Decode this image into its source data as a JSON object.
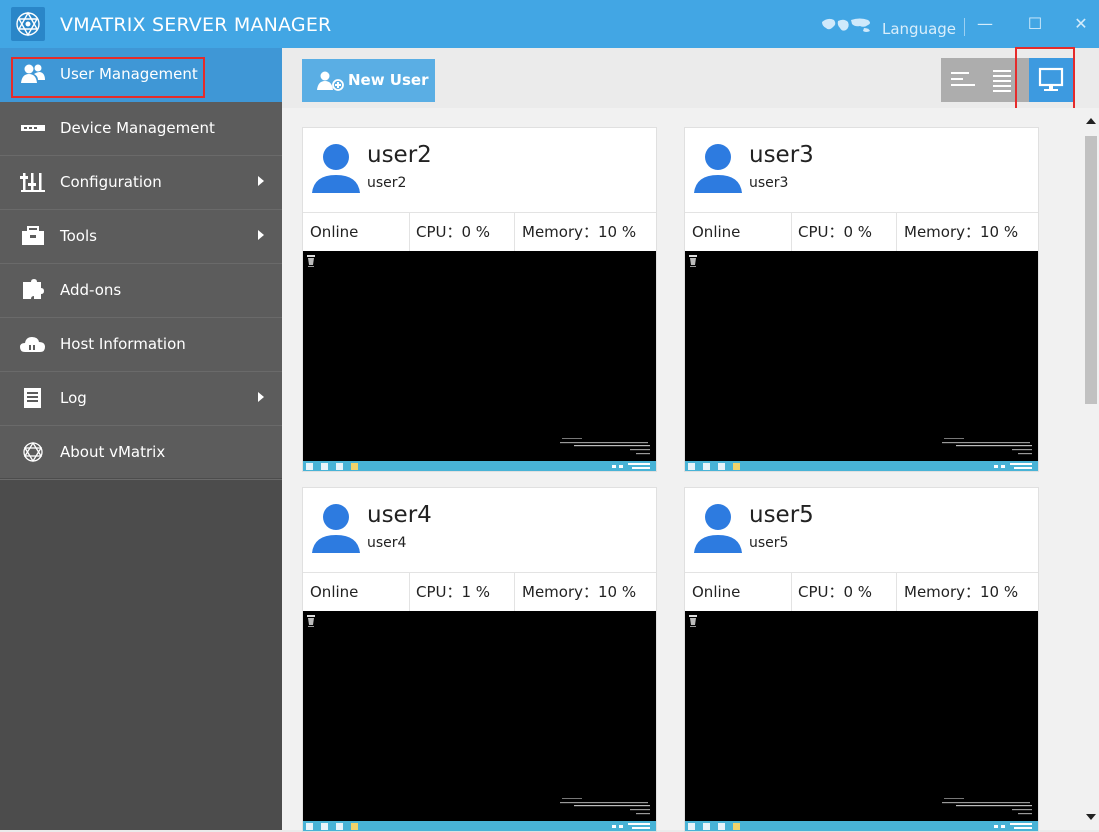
{
  "app": {
    "title": "VMATRIX SERVER MANAGER",
    "language_label": "Language",
    "accent_color": "#42a6e4",
    "highlight_color": "#e52b2b"
  },
  "window_controls": {
    "minimize": "—",
    "maximize": "☐",
    "close": "✕"
  },
  "sidebar": {
    "items": [
      {
        "label": "User Management",
        "icon": "users-icon",
        "active": true
      },
      {
        "label": "Device Management",
        "icon": "device-icon"
      },
      {
        "label": "Configuration",
        "icon": "sliders-icon",
        "has_submenu": true
      },
      {
        "label": "Tools",
        "icon": "toolbox-icon",
        "has_submenu": true
      },
      {
        "label": "Add-ons",
        "icon": "puzzle-icon"
      },
      {
        "label": "Host Information",
        "icon": "cloud-icon"
      },
      {
        "label": "Log",
        "icon": "log-icon",
        "has_submenu": true
      },
      {
        "label": "About vMatrix",
        "icon": "vmatrix-logo-icon"
      }
    ]
  },
  "toolbar": {
    "new_user_label": "New User",
    "views": [
      "list-view-icon",
      "detail-view-icon",
      "screen-view-icon"
    ],
    "selected_view": "screen-view-icon"
  },
  "users": [
    {
      "name": "user2",
      "subname": "user2",
      "status": "Online",
      "cpu_label": "CPU：",
      "cpu": "0 %",
      "mem_label": "Memory：",
      "memory": "10 %"
    },
    {
      "name": "user3",
      "subname": "user3",
      "status": "Online",
      "cpu_label": "CPU：",
      "cpu": "0 %",
      "mem_label": "Memory：",
      "memory": "10 %"
    },
    {
      "name": "user4",
      "subname": "user4",
      "status": "Online",
      "cpu_label": "CPU：",
      "cpu": "1 %",
      "mem_label": "Memory：",
      "memory": "10 %"
    },
    {
      "name": "user5",
      "subname": "user5",
      "status": "Online",
      "cpu_label": "CPU：",
      "cpu": "0 %",
      "mem_label": "Memory：",
      "memory": "10 %"
    }
  ]
}
